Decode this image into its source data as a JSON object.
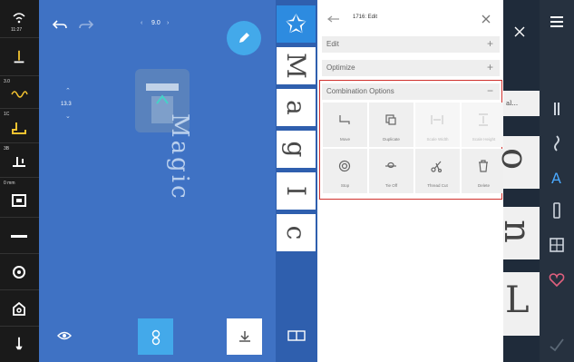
{
  "status_rail": {
    "items": [
      {
        "label": "11:27",
        "icon": "wifi-icon"
      },
      {
        "label": "",
        "icon": "needle-icon"
      },
      {
        "label": "3.0",
        "icon": "stitch-width-icon"
      },
      {
        "label": "1C",
        "icon": "presser-foot-icon"
      },
      {
        "label": "3B",
        "icon": "foot-pressure-icon"
      },
      {
        "label": "0 mm",
        "icon": "hoop-icon"
      },
      {
        "label": "",
        "icon": "thread-tension-icon"
      },
      {
        "label": "",
        "icon": "bobbin-icon"
      },
      {
        "label": "",
        "icon": "home-icon"
      },
      {
        "label": "",
        "icon": "pin-icon"
      }
    ]
  },
  "canvas": {
    "spacing_value": "9.0",
    "side_value": "13.3",
    "design_text": "Magic",
    "colors": {
      "background": "#3f72c4",
      "fab": "#43a9ea"
    }
  },
  "letter_strip": {
    "tiles": [
      "✩",
      "M",
      "a",
      "g",
      "I",
      "c"
    ]
  },
  "edit_panel": {
    "title": "1716: Edit",
    "sections": [
      {
        "label": "Edit",
        "symbol": "+"
      },
      {
        "label": "Optimize",
        "symbol": "+"
      },
      {
        "label": "Combination Options",
        "symbol": "−"
      }
    ],
    "options": [
      {
        "label": "Move",
        "icon": "move-icon",
        "enabled": true
      },
      {
        "label": "Duplicate",
        "icon": "duplicate-icon",
        "enabled": true
      },
      {
        "label": "Scale Width",
        "icon": "scale-width-icon",
        "enabled": false
      },
      {
        "label": "Scale Height",
        "icon": "scale-height-icon",
        "enabled": false
      },
      {
        "label": "Stop",
        "icon": "stop-icon",
        "enabled": true
      },
      {
        "label": "Tie Off",
        "icon": "tie-off-icon",
        "enabled": true
      },
      {
        "label": "Thread Cut",
        "icon": "scissors-icon",
        "enabled": true
      },
      {
        "label": "Delete",
        "icon": "trash-icon",
        "enabled": true
      }
    ],
    "highlight_color": "#d0312d"
  },
  "right_preview": {
    "labels": [
      "al...",
      "o",
      "n",
      "L"
    ]
  }
}
